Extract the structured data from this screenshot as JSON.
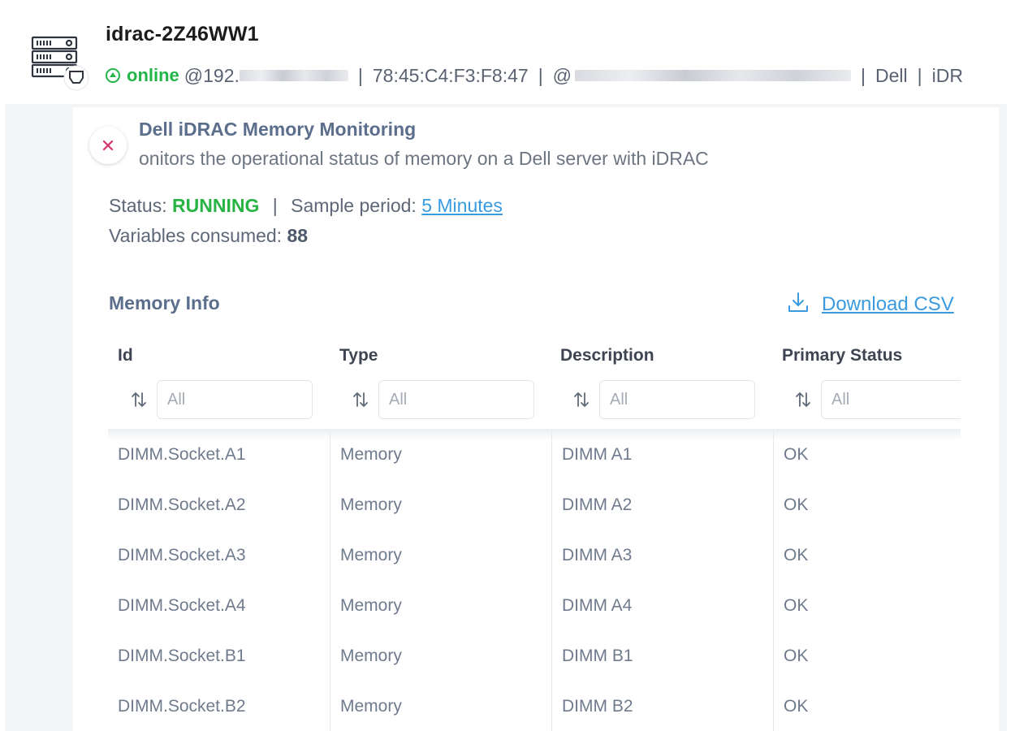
{
  "device": {
    "hostname": "idrac-2Z46WW1",
    "status": "online",
    "ip_prefix": "@192.",
    "mac": "78:45:C4:F3:F8:47",
    "domain_prefix": "@",
    "vendor": "Dell",
    "model_partial": "iDR",
    "separator": "|",
    "status_color": "#22b548"
  },
  "monitor": {
    "title": "Dell iDRAC Memory Monitoring",
    "description": "onitors the operational status of memory on a Dell server with iDRAC",
    "status_label": "Status:",
    "status_value": "RUNNING",
    "sample_label": "Sample period:",
    "sample_value": "5 Minutes",
    "vars_label": "Variables consumed:",
    "vars_value": "88"
  },
  "section": {
    "title": "Memory Info",
    "download_label": "Download CSV"
  },
  "table": {
    "columns": [
      {
        "key": "id",
        "label": "Id",
        "filter_placeholder": "All"
      },
      {
        "key": "type",
        "label": "Type",
        "filter_placeholder": "All"
      },
      {
        "key": "description",
        "label": "Description",
        "filter_placeholder": "All"
      },
      {
        "key": "primary_status",
        "label": "Primary Status",
        "filter_placeholder": "All"
      }
    ],
    "rows": [
      [
        "DIMM.Socket.A1",
        "Memory",
        "DIMM A1",
        "OK"
      ],
      [
        "DIMM.Socket.A2",
        "Memory",
        "DIMM A2",
        "OK"
      ],
      [
        "DIMM.Socket.A3",
        "Memory",
        "DIMM A3",
        "OK"
      ],
      [
        "DIMM.Socket.A4",
        "Memory",
        "DIMM A4",
        "OK"
      ],
      [
        "DIMM.Socket.B1",
        "Memory",
        "DIMM B1",
        "OK"
      ],
      [
        "DIMM.Socket.B2",
        "Memory",
        "DIMM B2",
        "OK"
      ]
    ]
  },
  "colors": {
    "accent_link": "#3b9be0",
    "running": "#27b443",
    "close": "#d6336c",
    "heading": "#5b6e8c"
  },
  "icons": {
    "device": "server-rack-icon",
    "status": "arrow-up-circle-icon",
    "close": "close-icon",
    "download": "download-icon",
    "sort": "sort-arrows-icon"
  }
}
